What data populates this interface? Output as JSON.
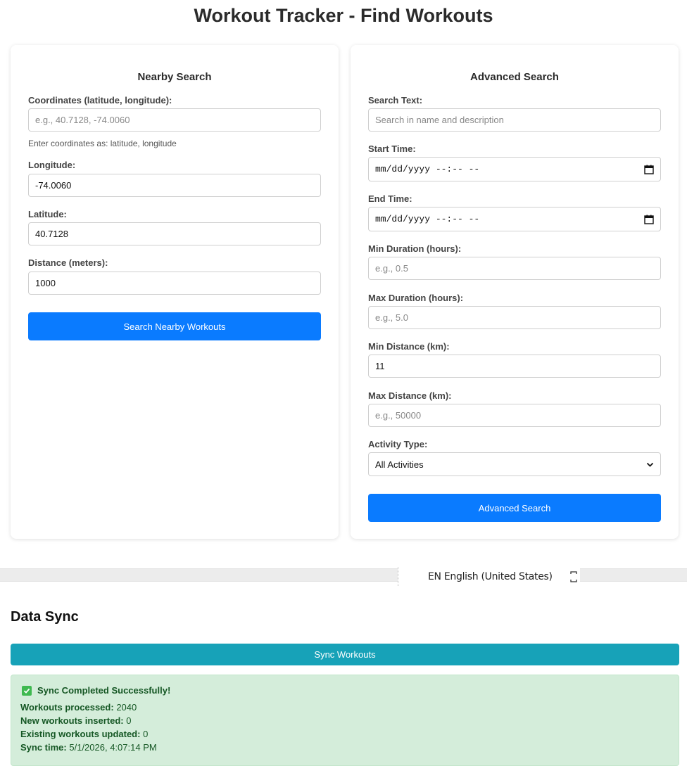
{
  "page": {
    "title": "Workout Tracker - Find Workouts"
  },
  "nearby": {
    "title": "Nearby Search",
    "coords_label": "Coordinates (latitude, longitude):",
    "coords_placeholder": "e.g., 40.7128, -74.0060",
    "coords_hint": "Enter coordinates as: latitude, longitude",
    "longitude_label": "Longitude:",
    "longitude_value": "-74.0060",
    "latitude_label": "Latitude:",
    "latitude_value": "40.7128",
    "distance_label": "Distance (meters):",
    "distance_value": "1000",
    "button_label": "Search Nearby Workouts"
  },
  "advanced": {
    "title": "Advanced Search",
    "search_text_label": "Search Text:",
    "search_text_placeholder": "Search in name and description",
    "start_time_label": "Start Time:",
    "start_time_value": "mm/dd/yyyy --:-- --",
    "end_time_label": "End Time:",
    "end_time_value": "mm/dd/yyyy --:-- --",
    "min_duration_label": "Min Duration (hours):",
    "min_duration_placeholder": "e.g., 0.5",
    "max_duration_label": "Max Duration (hours):",
    "max_duration_placeholder": "e.g., 5.0",
    "min_distance_label": "Min Distance (km):",
    "min_distance_value": "11",
    "max_distance_label": "Max Distance (km):",
    "max_distance_placeholder": "e.g., 50000",
    "activity_type_label": "Activity Type:",
    "activity_type_value": "All Activities",
    "button_label": "Advanced Search"
  },
  "language_bar": {
    "text": "EN English (United States)"
  },
  "sync": {
    "title": "Data Sync",
    "button_label": "Sync Workouts",
    "status_title": "Sync Completed Successfully!",
    "processed_label": "Workouts processed:",
    "processed_value": "2040",
    "inserted_label": "New workouts inserted:",
    "inserted_value": "0",
    "updated_label": "Existing workouts updated:",
    "updated_value": "0",
    "time_label": "Sync time:",
    "time_value": "5/1/2026, 4:07:14 PM"
  },
  "colors": {
    "primary": "#0a7bff",
    "sync_button": "#17a2b8",
    "success_bg": "#d4edda",
    "success_text": "#155724"
  },
  "icons": {
    "calendar": "calendar-icon",
    "dropdown": "chevron-down-icon",
    "success": "check-icon",
    "language_options": "keyboard-options-icon"
  }
}
